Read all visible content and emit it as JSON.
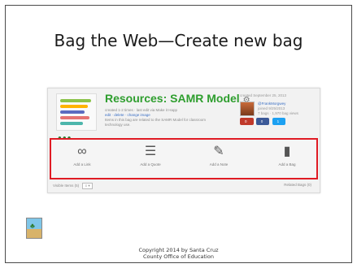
{
  "slide": {
    "title": "Bag the Web—Create new bag",
    "copyright_line1": "Copyright 2014 by Santa Cruz",
    "copyright_line2": "County Office of Education"
  },
  "bag": {
    "title": "Resources: SAMR Model",
    "meta_line1": "created 1-2 times · last edit via Make it Happ",
    "meta_links": "edit · delete · change image",
    "description_line1": "Items in this bag are related to the SAMR Model for classroom",
    "description_line2": "technology use.",
    "created": "created September 25, 2013",
    "user_handle": "@FrankMorgwey",
    "user_line2": "joined 9/25/2013",
    "user_line3": "7 bags · 1,970 bag views",
    "tag_counts": {
      "like": "0",
      "views": "0",
      "shares": "1"
    }
  },
  "actions": [
    {
      "label": "Add a Link",
      "icon": "link-icon"
    },
    {
      "label": "Add a Quote",
      "icon": "list-icon"
    },
    {
      "label": "Add a Note",
      "icon": "pencil-icon"
    },
    {
      "label": "Add a Bag",
      "icon": "bag-icon"
    }
  ],
  "footer": {
    "visible_items": "Visible Items (5)",
    "related_bags": "Related Bags (0)"
  },
  "colors": {
    "highlight": "#e01b24",
    "bag_title": "#2e9e2e",
    "link": "#3a6fc4"
  }
}
